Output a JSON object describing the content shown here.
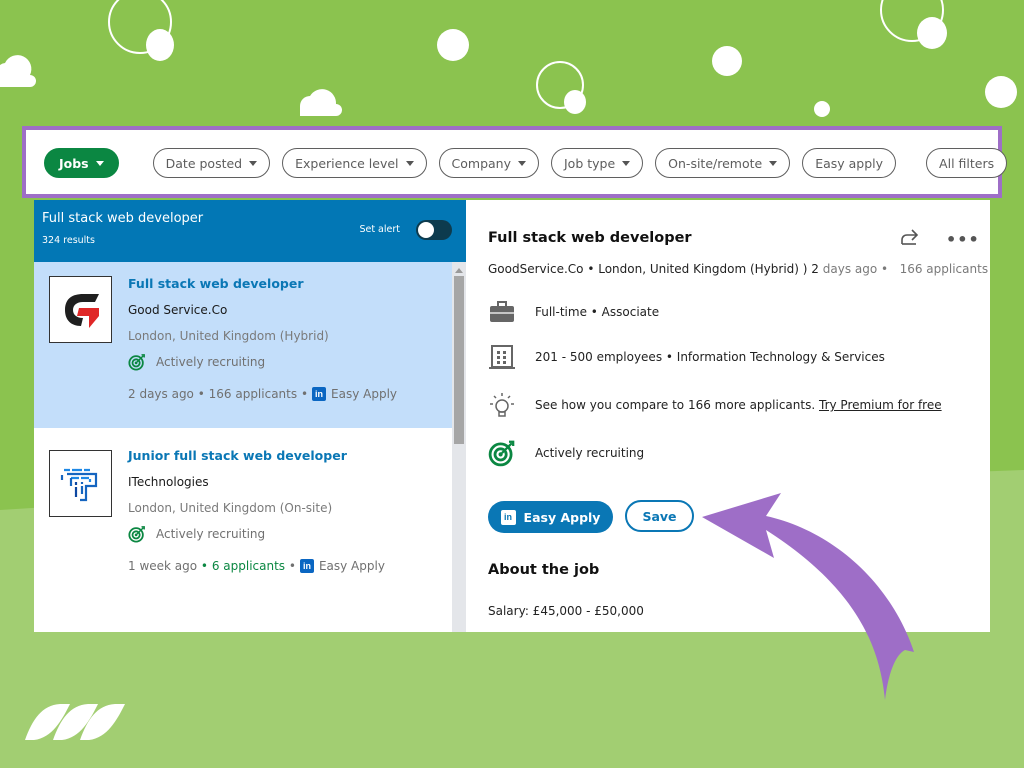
{
  "filters": {
    "jobs_label": "Jobs",
    "items": [
      {
        "label": "Date posted",
        "has_dropdown": true
      },
      {
        "label": "Experience level",
        "has_dropdown": true
      },
      {
        "label": "Company",
        "has_dropdown": true
      },
      {
        "label": "Job type",
        "has_dropdown": true
      },
      {
        "label": "On-site/remote",
        "has_dropdown": true
      },
      {
        "label": "Easy apply",
        "has_dropdown": false
      }
    ],
    "all_filters_label": "All filters"
  },
  "search": {
    "query": "Full stack web developer",
    "results": "324 results",
    "alert_label": "Set alert",
    "alert_on": false
  },
  "jobs": [
    {
      "title": "Full stack web developer",
      "company": "Good Service.Co",
      "location": "London, United Kingdom (Hybrid)",
      "status": "Actively recruiting",
      "posted": "2 days ago",
      "applicants": "166 applicants",
      "apply": "Easy Apply",
      "logo_icon": "g-logo-icon",
      "selected": true
    },
    {
      "title": "Junior full stack web developer",
      "company": "ITechnologies",
      "location": "London, United Kingdom (On-site)",
      "status": "Actively recruiting",
      "posted": "1 week ago",
      "applicants": "6 applicants",
      "apply": "Easy Apply",
      "logo_icon": "t-logo-icon",
      "selected": false
    }
  ],
  "detail": {
    "title": "Full stack web developer",
    "company": "GoodService.Co",
    "location": "London, United Kingdom (Hybrid) )",
    "posted_num": "2",
    "posted_rest": "days ago",
    "applicants": "166 applicants",
    "employment": "Full-time • Associate",
    "company_info": "201 - 500 employees • Information Technology & Services",
    "insight_text": "See how you compare to 166 more applicants.",
    "premium_link": "Try Premium for free",
    "status": "Actively recruiting",
    "apply_label": "Easy Apply",
    "save_label": "Save",
    "about_title": "About the job",
    "salary": "Salary: £45,000 - £50,000",
    "more_icon": "•••"
  },
  "colors": {
    "background_green": "#8bc34f",
    "frame_purple": "#9e6ec7",
    "linkedin_blue": "#0a77b5",
    "jobs_green": "#0b8742",
    "selected_card": "#c3defa"
  }
}
